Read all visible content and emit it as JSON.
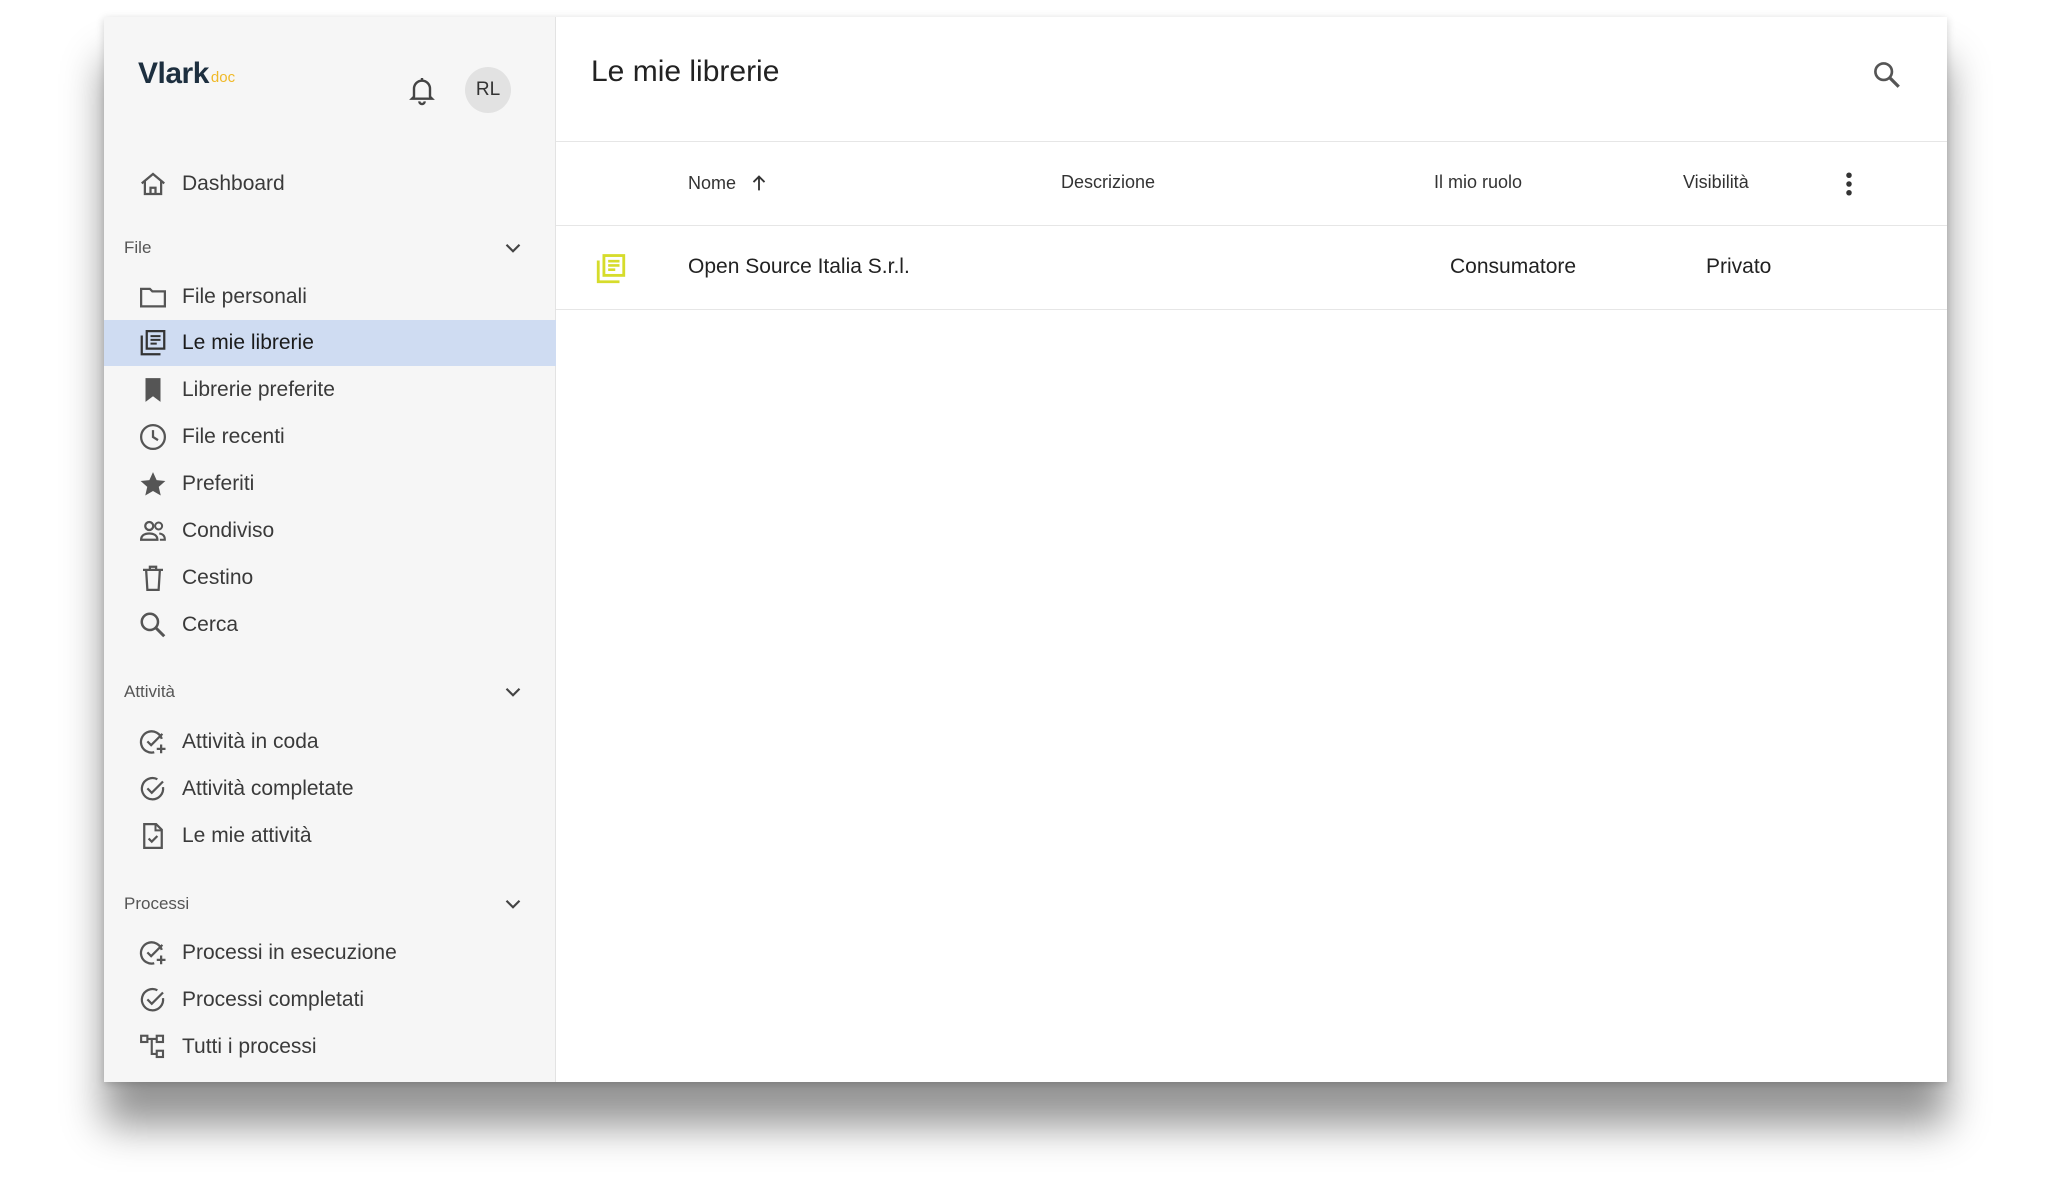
{
  "app": {
    "logo_text": "Vlark",
    "logo_suffix": "doc",
    "avatar_initials": "RL"
  },
  "sidebar": {
    "dashboard": {
      "label": "Dashboard",
      "icon": "home-icon"
    },
    "sections": [
      {
        "title": "File",
        "items": [
          {
            "label": "File personali",
            "icon": "folder-icon"
          },
          {
            "label": "Le mie librerie",
            "icon": "library-icon",
            "active": true
          },
          {
            "label": "Librerie preferite",
            "icon": "bookmark-icon"
          },
          {
            "label": "File recenti",
            "icon": "clock-icon"
          },
          {
            "label": "Preferiti",
            "icon": "star-icon"
          },
          {
            "label": "Condiviso",
            "icon": "people-icon"
          },
          {
            "label": "Cestino",
            "icon": "trash-icon"
          },
          {
            "label": "Cerca",
            "icon": "search-icon"
          }
        ]
      },
      {
        "title": "Attività",
        "items": [
          {
            "label": "Attività in coda",
            "icon": "check-plus-icon"
          },
          {
            "label": "Attività completate",
            "icon": "check-circle-icon"
          },
          {
            "label": "Le mie attività",
            "icon": "task-document-icon"
          }
        ]
      },
      {
        "title": "Processi",
        "items": [
          {
            "label": "Processi in esecuzione",
            "icon": "check-plus-icon"
          },
          {
            "label": "Processi completati",
            "icon": "check-circle-icon"
          },
          {
            "label": "Tutti i processi",
            "icon": "process-tree-icon"
          }
        ]
      }
    ]
  },
  "main": {
    "title": "Le mie librerie",
    "table": {
      "columns": [
        "Nome",
        "Descrizione",
        "Il mio ruolo",
        "Visibilità"
      ],
      "sort": {
        "column": "Nome",
        "direction": "ascending"
      },
      "rows": [
        {
          "name": "Open Source Italia S.r.l.",
          "description": "",
          "role": "Consumatore",
          "visibility": "Privato",
          "icon_color": "#d6dc2b"
        }
      ]
    }
  },
  "colors": {
    "sidebar_bg": "#f6f6f6",
    "active_bg": "#cfdcf2",
    "logo_dark": "#1d2f3f",
    "logo_accent": "#f0b928",
    "library_icon": "#d6dc2b"
  }
}
